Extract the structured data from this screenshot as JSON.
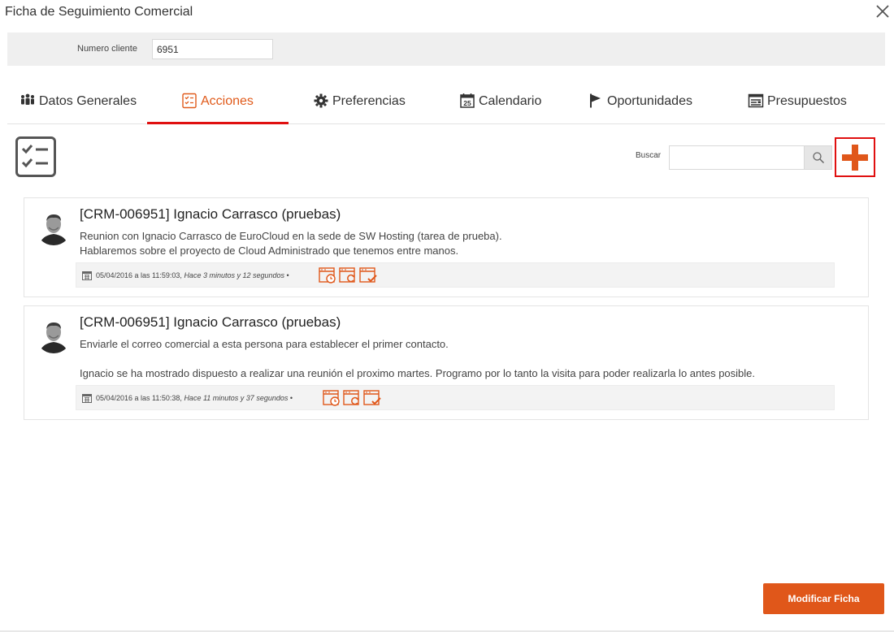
{
  "modal": {
    "title": "Ficha de Seguimiento Comercial"
  },
  "client": {
    "label": "Numero cliente",
    "value": "6951"
  },
  "tabs": [
    {
      "label": "Datos Generales",
      "icon": "users-icon"
    },
    {
      "label": "Acciones",
      "icon": "checklist-icon",
      "active": true
    },
    {
      "label": "Preferencias",
      "icon": "gear-icon"
    },
    {
      "label": "Calendario",
      "icon": "calendar-25-icon"
    },
    {
      "label": "Oportunidades",
      "icon": "flag-icon"
    },
    {
      "label": "Presupuestos",
      "icon": "document-list-icon"
    }
  ],
  "search": {
    "label": "Buscar",
    "value": "",
    "placeholder": ""
  },
  "actions": [
    {
      "title": "[CRM-006951] Ignacio Carrasco (pruebas)",
      "lines": [
        "Reunion con Ignacio Carrasco de EuroCloud en la sede de SW Hosting (tarea de prueba).",
        "Hablaremos sobre el proyecto de Cloud Administrado que tenemos entre manos."
      ],
      "date": "05/04/2016 a las 11:59:03,",
      "ago": "Hace 3 minutos y 12 segundos",
      "sep": "•"
    },
    {
      "title": "[CRM-006951] Ignacio Carrasco (pruebas)",
      "lines": [
        "Enviarle el correo comercial a esta persona para establecer el primer contacto.",
        "Ignacio se ha mostrado dispuesto a realizar una reunión el proximo martes. Programo por lo tanto la visita para poder realizarla lo antes posible."
      ],
      "date": "05/04/2016 a las 11:50:38,",
      "ago": "Hace 11 minutos y 37 segundos",
      "sep": "•"
    }
  ],
  "footer": {
    "submit_label": "Modificar Ficha"
  },
  "colors": {
    "accent": "#e0571a",
    "highlight": "#e01010"
  }
}
